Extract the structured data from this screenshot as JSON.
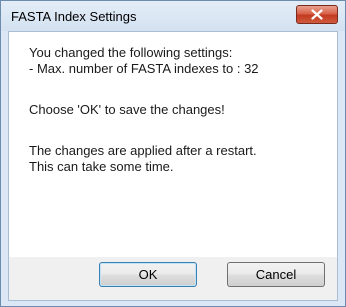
{
  "window": {
    "title": "FASTA Index Settings"
  },
  "message": {
    "line1": "You changed the following settings:",
    "line2": "- Max. number of FASTA indexes to : 32",
    "line3": "Choose 'OK' to save the changes!",
    "line4": "The changes are applied after a restart.",
    "line5": "This can take some time."
  },
  "buttons": {
    "ok_label": "OK",
    "cancel_label": "Cancel"
  },
  "icons": {
    "close": "close-icon"
  },
  "colors": {
    "close_button": "#c23a1f",
    "title_bar": "#d3e1f0"
  }
}
